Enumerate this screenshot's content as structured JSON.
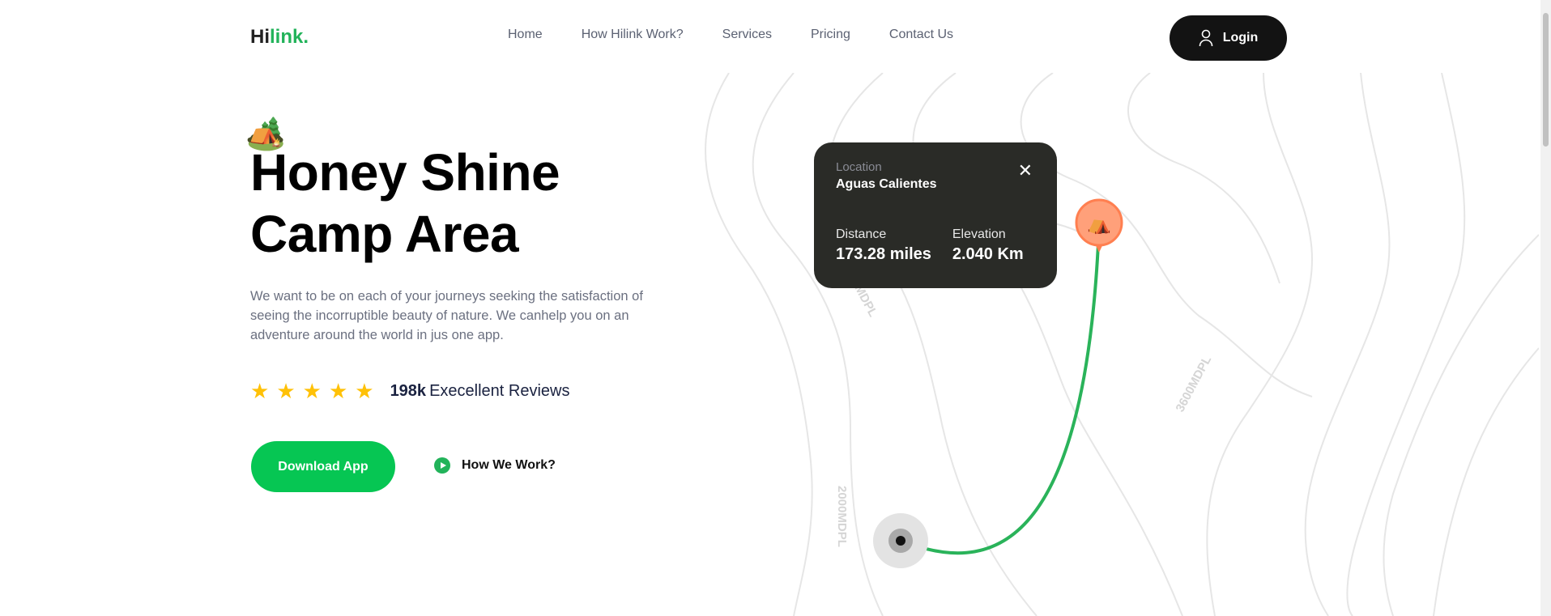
{
  "logo": {
    "dark": "Hi",
    "green": "link."
  },
  "nav": [
    "Home",
    "How Hilink Work?",
    "Services",
    "Pricing",
    "Contact Us"
  ],
  "login": "Login",
  "hero": {
    "title_line1": "Honey Shine",
    "title_line2": "Camp Area",
    "description": "We want to be on each of your journeys seeking the satisfaction of seeing the incorruptible beauty of nature. We canhelp you on an adventure around the world in jus one app.",
    "rating": 5,
    "review_count": "198k",
    "review_label": "Execellent Reviews",
    "download": "Download App",
    "how": "How We Work?"
  },
  "card": {
    "location_label": "Location",
    "location": "Aguas Calientes",
    "distance_label": "Distance",
    "distance": "173.28 miles",
    "elevation_label": "Elevation",
    "elevation": "2.040 Km"
  },
  "map_labels": [
    "2000MDPL",
    "3600MDPL",
    "MDPL"
  ],
  "colors": {
    "green": "#06c653",
    "pin": "#ff7f50",
    "card": "#2a2b27"
  }
}
